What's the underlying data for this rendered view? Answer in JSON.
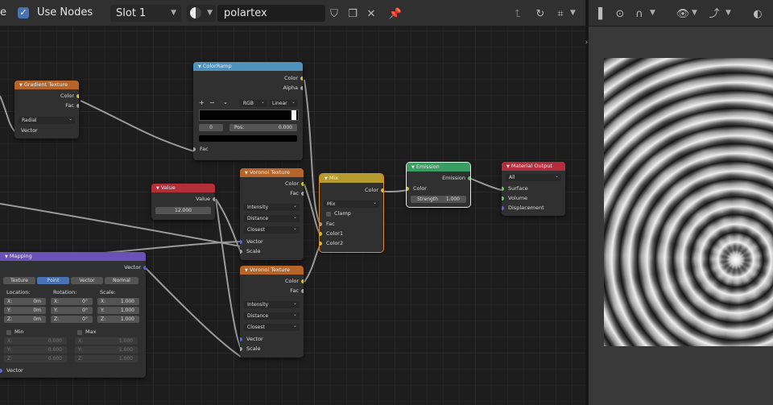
{
  "header": {
    "left_fragment": "e",
    "use_nodes_label": "Use Nodes",
    "use_nodes_checked": true,
    "slot_label": "Slot 1",
    "material_name": "polartex"
  },
  "nodes": {
    "gradient": {
      "title": "Gradient Texture",
      "out_color": "Color",
      "out_fac": "Fac",
      "type": "Radial",
      "in_vector": "Vector"
    },
    "colorramp": {
      "title": "ColorRamp",
      "out_color": "Color",
      "out_alpha": "Alpha",
      "mode": "RGB",
      "interp": "Linear",
      "index": "0",
      "pos_label": "Pos:",
      "pos_value": "0.000",
      "in_fac": "Fac"
    },
    "value": {
      "title": "Value",
      "out_value": "Value",
      "value": "12.000"
    },
    "voronoi1": {
      "title": "Voronoi Texture",
      "out_color": "Color",
      "out_fac": "Fac",
      "coloring": "Intensity",
      "distance": "Distance",
      "feature": "Closest",
      "in_vector": "Vector",
      "in_scale": "Scale"
    },
    "voronoi2": {
      "title": "Voronoi Texture",
      "out_color": "Color",
      "out_fac": "Fac",
      "coloring": "Intensity",
      "distance": "Distance",
      "feature": "Closest",
      "in_vector": "Vector",
      "in_scale": "Scale"
    },
    "mix": {
      "title": "Mix",
      "out_color": "Color",
      "blend": "Mix",
      "clamp_label": "Clamp",
      "clamp_checked": false,
      "in_fac": "Fac",
      "in_color1": "Color1",
      "in_color2": "Color2"
    },
    "emission": {
      "title": "Emission",
      "out_emission": "Emission",
      "in_color": "Color",
      "strength_label": "Strength",
      "strength_value": "1.000"
    },
    "output": {
      "title": "Material Output",
      "target": "All",
      "in_surface": "Surface",
      "in_volume": "Volume",
      "in_displacement": "Displacement"
    },
    "mapping": {
      "title": "Mapping",
      "out_vector": "Vector",
      "tabs": [
        "Texture",
        "Point",
        "Vector",
        "Normal"
      ],
      "active_tab": "Point",
      "location_label": "Location:",
      "rotation_label": "Rotation:",
      "scale_label": "Scale:",
      "loc": [
        {
          "axis": "X:",
          "v": "0m"
        },
        {
          "axis": "Y:",
          "v": "0m"
        },
        {
          "axis": "Z:",
          "v": "0m"
        }
      ],
      "rot": [
        {
          "axis": "X:",
          "v": "0°"
        },
        {
          "axis": "Y:",
          "v": "0°"
        },
        {
          "axis": "Z:",
          "v": "0°"
        }
      ],
      "scl": [
        {
          "axis": "X:",
          "v": "1.000"
        },
        {
          "axis": "Y:",
          "v": "1.000"
        },
        {
          "axis": "Z:",
          "v": "1.000"
        }
      ],
      "min_label": "Min",
      "max_label": "Max",
      "min": [
        {
          "axis": "X:",
          "v": "0.000"
        },
        {
          "axis": "Y:",
          "v": "0.000"
        },
        {
          "axis": "Z:",
          "v": "0.000"
        }
      ],
      "max": [
        {
          "axis": "X:",
          "v": "1.000"
        },
        {
          "axis": "Y:",
          "v": "1.000"
        },
        {
          "axis": "Z:",
          "v": "1.000"
        }
      ],
      "in_vector": "Vector"
    }
  },
  "colors": {
    "header_texture": "#b5652a",
    "header_converter": "#4f93bd",
    "header_input": "#b22f3a",
    "header_mix": "#b59a2e",
    "header_shader": "#3a9e63",
    "header_output": "#b52d3c",
    "header_vector": "#6a51b8"
  }
}
